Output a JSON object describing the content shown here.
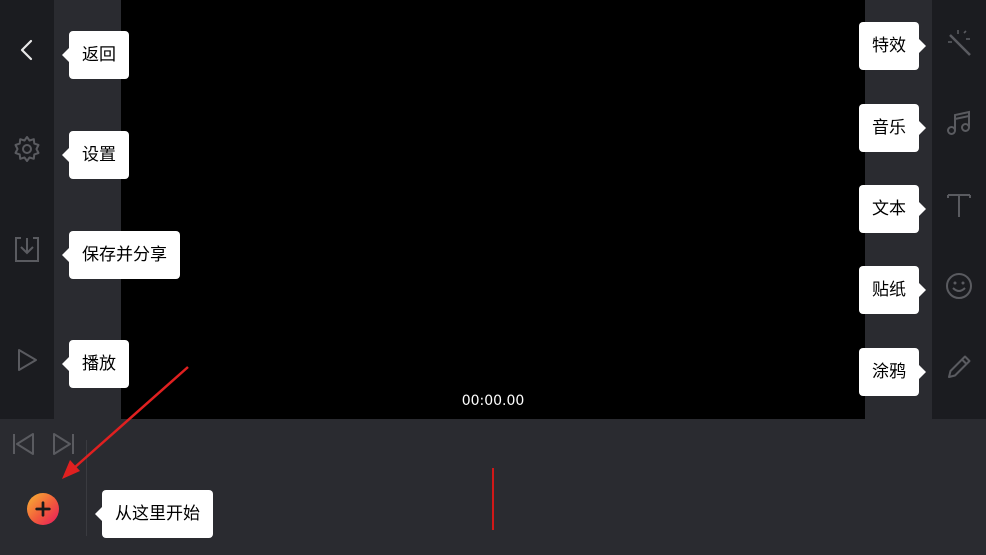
{
  "preview": {
    "timecode": "00:00.00"
  },
  "left_toolbar": {
    "back_tip": "返回",
    "settings_tip": "设置",
    "save_tip": "保存并分享",
    "play_tip": "播放"
  },
  "right_toolbar": {
    "effects_tip": "特效",
    "music_tip": "音乐",
    "text_tip": "文本",
    "sticker_tip": "贴纸",
    "doodle_tip": "涂鸦"
  },
  "timeline": {
    "start_tip": "从这里开始"
  },
  "colors": {
    "rail": "#1b1c20",
    "panel": "#2a2b30",
    "icon": "#5a5b60",
    "playhead": "#d01818",
    "arrow": "#e02020"
  },
  "icons": [
    "chevron-left-icon",
    "gear-icon",
    "download-icon",
    "play-icon",
    "magic-wand-icon",
    "music-note-icon",
    "text-t-icon",
    "smiley-icon",
    "pencil-icon",
    "skip-start-icon",
    "skip-end-icon",
    "plus-icon"
  ]
}
